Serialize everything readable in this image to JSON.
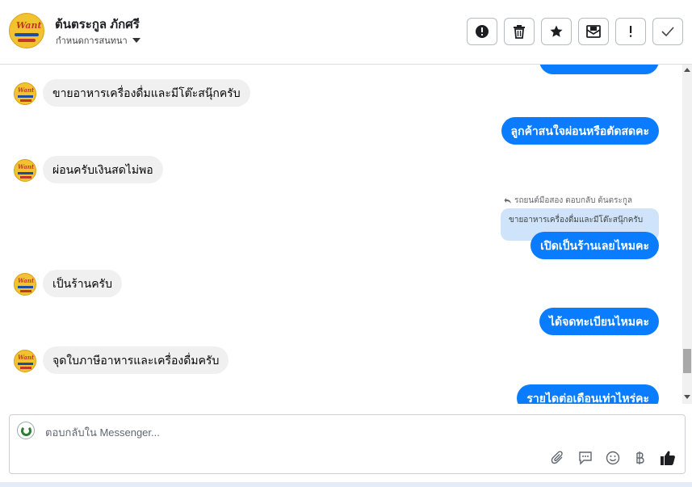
{
  "header": {
    "contact_name": "ต้นตระกูล ภักศรี",
    "assign_label": "กำหนดการสนทนา",
    "avatar_logo_text": "Want"
  },
  "toolbar": {
    "buttons": [
      {
        "name": "spam-report-button",
        "icon": "alert-circle-icon"
      },
      {
        "name": "delete-button",
        "icon": "trash-icon"
      },
      {
        "name": "star-button",
        "icon": "star-icon"
      },
      {
        "name": "mark-unread-button",
        "icon": "envelope-icon"
      },
      {
        "name": "follow-up-button",
        "icon": "exclamation-icon"
      },
      {
        "name": "done-button",
        "icon": "check-icon"
      }
    ]
  },
  "messages": [
    {
      "id": "m1",
      "direction": "in",
      "text": "ขายอาหารเครื่องดื่มและมีโต๊ะสนุ๊กครับ"
    },
    {
      "id": "m2",
      "direction": "out",
      "text": "ลูกค้าสนใจผ่อนหรือตัดสดคะ"
    },
    {
      "id": "m3",
      "direction": "in",
      "text": "ผ่อนครับเงินสดไม่พอ"
    },
    {
      "id": "m4",
      "direction": "out",
      "text": "เปิดเป็นร้านเลยไหมคะ",
      "reply_meta": "รถยนต์มือสอง ตอบกลับ ต้นตระกูล",
      "quoted_text": "ขายอาหารเครื่องดื่มและมีโต๊ะสนุ๊กครับ"
    },
    {
      "id": "m5",
      "direction": "in",
      "text": "เป็นร้านครับ"
    },
    {
      "id": "m6",
      "direction": "out",
      "text": "ได้จดทะเบียนไหมคะ"
    },
    {
      "id": "m7",
      "direction": "in",
      "text": "จุดใบภาษีอาหารและเครื่องดื่มครับ"
    },
    {
      "id": "m8",
      "direction": "out",
      "text": "รายไดต่อเดือนเท่าไหร่คะ"
    }
  ],
  "composer": {
    "placeholder": "ตอบกลับใน Messenger...",
    "value": "",
    "actions": [
      "paperclip-icon",
      "quick-reply-icon",
      "emoji-icon",
      "baht-icon",
      "thumbs-up-icon"
    ]
  },
  "colors": {
    "outgoing_bubble": "#0a7cff",
    "incoming_bubble": "#f0f0f0",
    "quoted_bubble": "#cfe4fb",
    "thumbs_up": "#1c1e21"
  }
}
